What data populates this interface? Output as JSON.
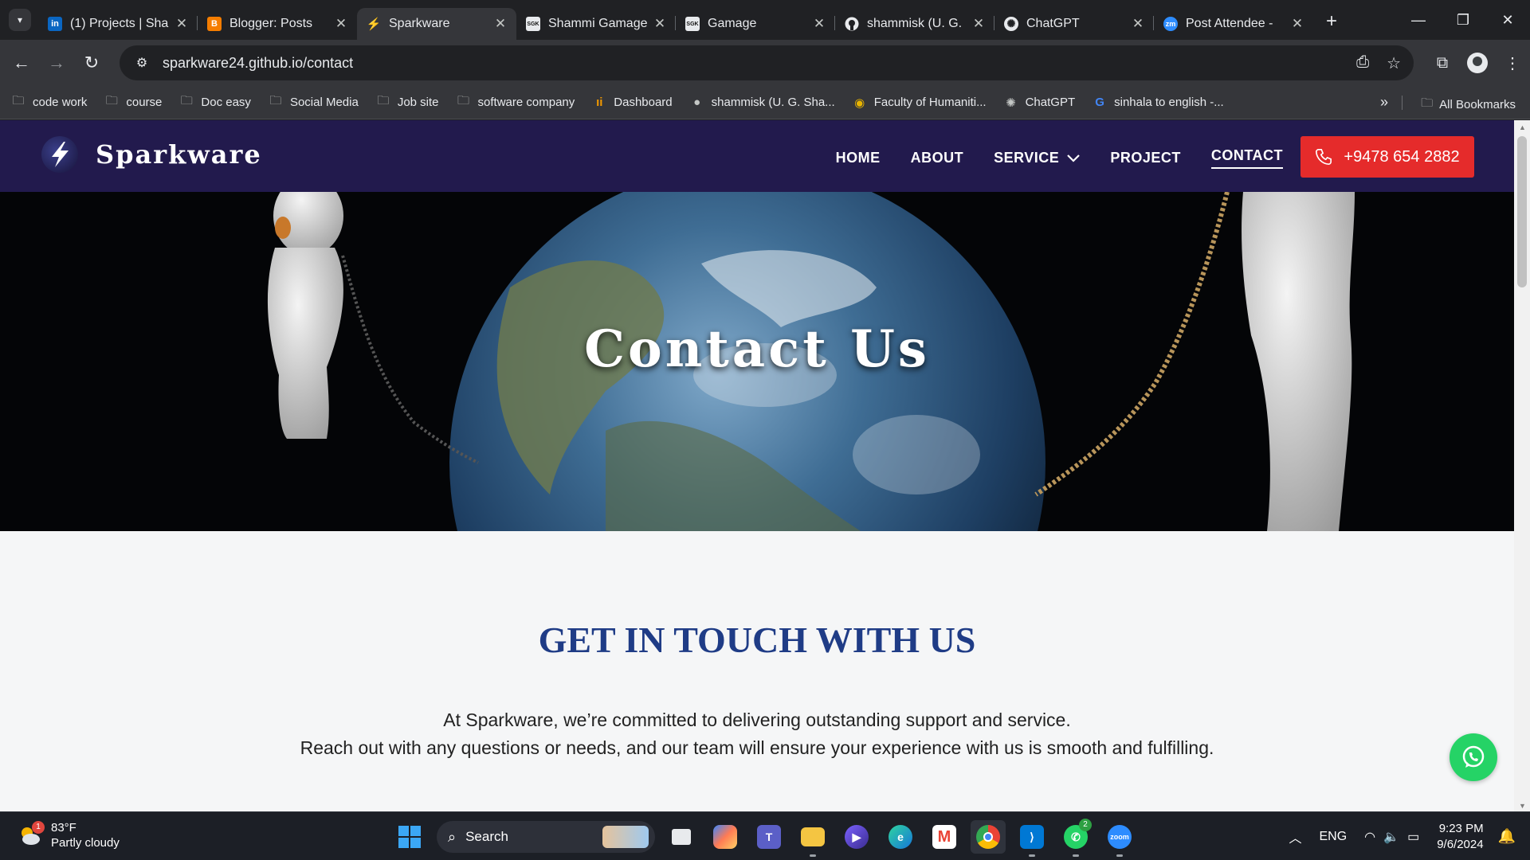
{
  "browser": {
    "tabs": [
      {
        "title": "(1) Projects | Sha",
        "favicon": "linkedin-icon",
        "color": "#0a66c2",
        "glyph": "in"
      },
      {
        "title": "Blogger: Posts",
        "favicon": "blogger-icon",
        "color": "#f57d00",
        "glyph": "B"
      },
      {
        "title": "Sparkware",
        "favicon": "sparkware-icon",
        "color": "#2a2f6e",
        "glyph": "⚡"
      },
      {
        "title": "Shammi Gamage",
        "favicon": "sgk-icon",
        "color": "#222222",
        "glyph": "SGK"
      },
      {
        "title": "Gamage",
        "favicon": "sgk-icon",
        "color": "#222222",
        "glyph": "SGK"
      },
      {
        "title": "shammisk (U. G.",
        "favicon": "github-icon",
        "color": "#ffffff",
        "glyph": "●"
      },
      {
        "title": "ChatGPT",
        "favicon": "chatgpt-icon",
        "color": "#ffffff",
        "glyph": "✺"
      },
      {
        "title": "Post Attendee -",
        "favicon": "zoom-icon",
        "color": "#2d8cff",
        "glyph": "zm"
      }
    ],
    "active_tab_index": 2,
    "url": "sparkware24.github.io/contact",
    "bookmarks": [
      {
        "label": "code work",
        "icon": "folder-icon"
      },
      {
        "label": "course",
        "icon": "folder-icon"
      },
      {
        "label": "Doc easy",
        "icon": "folder-icon"
      },
      {
        "label": "Social Media",
        "icon": "folder-icon"
      },
      {
        "label": "Job site",
        "icon": "folder-icon"
      },
      {
        "label": "software company",
        "icon": "folder-icon"
      },
      {
        "label": "Dashboard",
        "icon": "dashboard-icon"
      },
      {
        "label": "shammisk (U. G. Sha...",
        "icon": "github-icon"
      },
      {
        "label": "Faculty of Humaniti...",
        "icon": "faculty-icon"
      },
      {
        "label": "ChatGPT",
        "icon": "chatgpt-icon"
      },
      {
        "label": "sinhala to english -...",
        "icon": "google-icon"
      }
    ],
    "all_bookmarks_label": "All Bookmarks"
  },
  "site": {
    "logo_text": "Sparkware",
    "nav": [
      "HOME",
      "ABOUT",
      "SERVICE",
      "PROJECT",
      "CONTACT"
    ],
    "current_nav": "CONTACT",
    "phone": "+9478 654 2882",
    "hero_title": "Contact Us",
    "section_title": "GET IN TOUCH WITH US",
    "intro_line1": "At Sparkware, we’re committed to delivering outstanding support and service.",
    "intro_line2": "Reach out with any questions or needs, and our team will ensure your experience with us is smooth and fulfilling.",
    "colors": {
      "header_bg": "#221a4d",
      "accent_red": "#e52b2b",
      "title_blue": "#1f3c86",
      "whatsapp": "#25d366"
    }
  },
  "taskbar": {
    "weather_temp": "83°F",
    "weather_desc": "Partly cloudy",
    "weather_badge": "1",
    "search_label": "Search",
    "whatsapp_badge": "2",
    "lang": "ENG",
    "time": "9:23 PM",
    "date": "9/6/2024"
  }
}
